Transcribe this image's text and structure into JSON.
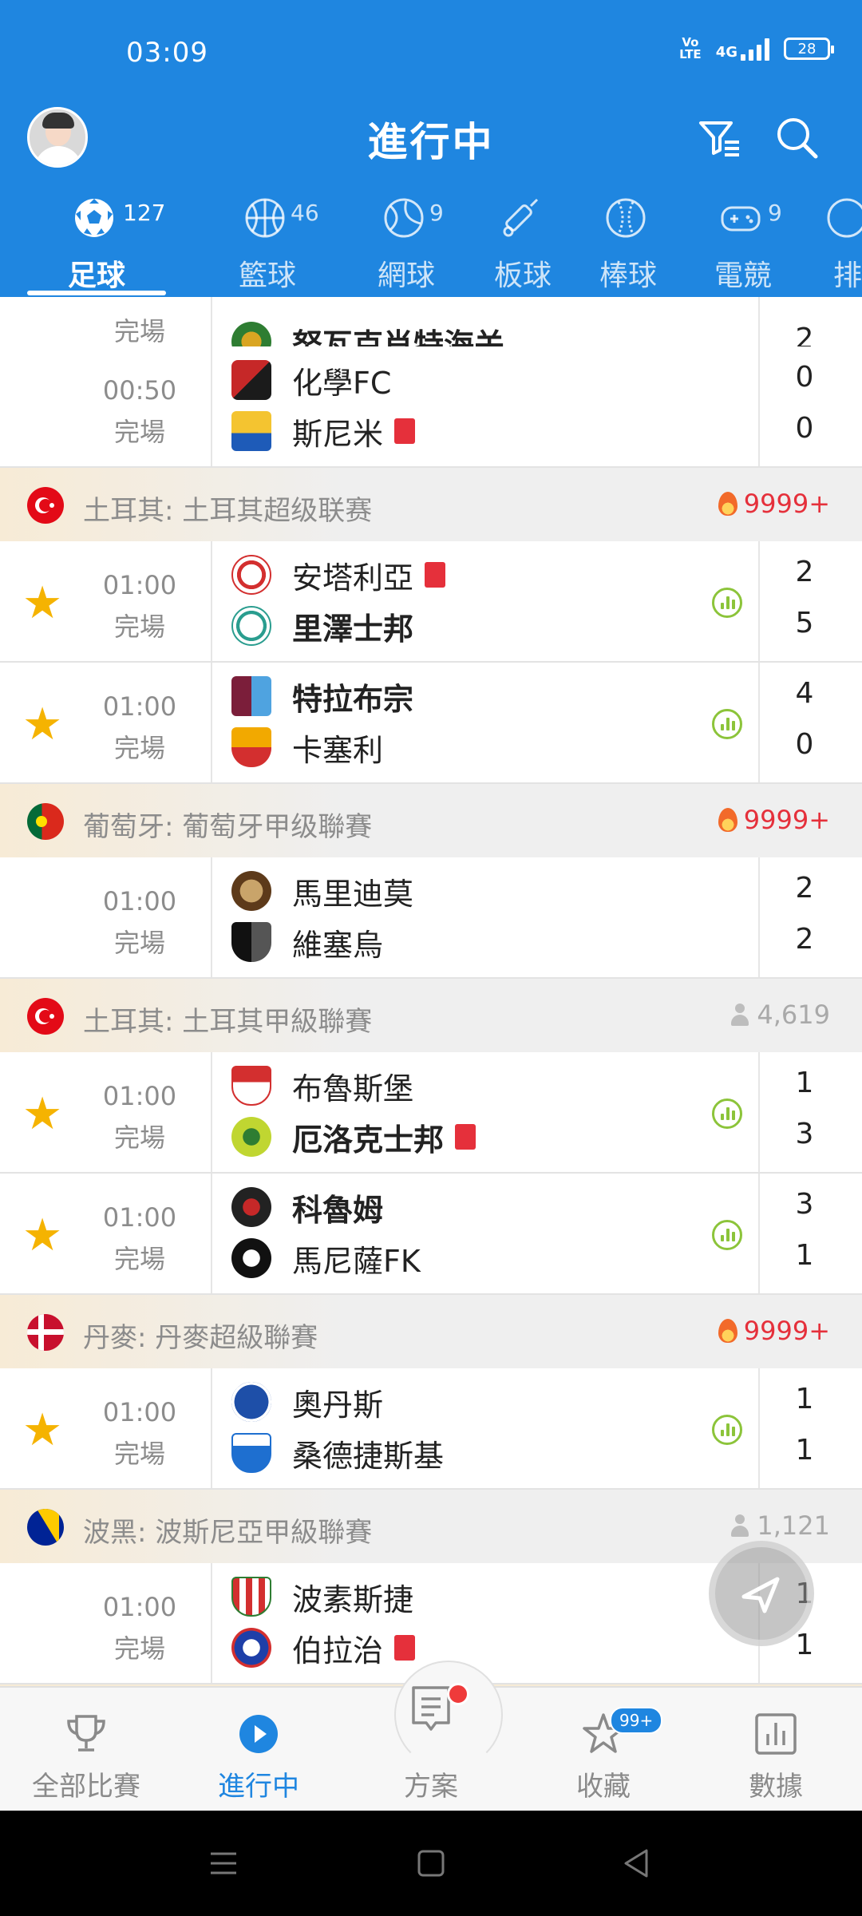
{
  "status_bar": {
    "time": "03:09",
    "network": "4G",
    "volte": "Vo\nLTE",
    "battery": "28"
  },
  "header": {
    "title": "進行中"
  },
  "sport_tabs": [
    {
      "label": "足球",
      "count": "127",
      "icon": "soccer-ball-icon",
      "active": true
    },
    {
      "label": "籃球",
      "count": "46",
      "icon": "basketball-icon"
    },
    {
      "label": "網球",
      "count": "9",
      "icon": "tennis-ball-icon"
    },
    {
      "label": "板球",
      "count": "",
      "icon": "cricket-bat-icon"
    },
    {
      "label": "棒球",
      "count": "",
      "icon": "baseball-icon"
    },
    {
      "label": "電競",
      "count": "9",
      "icon": "gamepad-icon"
    },
    {
      "label": "排",
      "count": "",
      "icon": "volleyball-icon"
    }
  ],
  "matches": {
    "m0": {
      "status": "完場",
      "away": "努瓦克肖特海关",
      "away_score": "2"
    },
    "m1": {
      "time": "00:50",
      "status": "完場",
      "home": "化學FC",
      "away": "斯尼米",
      "home_score": "0",
      "away_score": "0"
    },
    "l1": {
      "name": "土耳其: 土耳其超级联赛",
      "heat": "9999+"
    },
    "m2": {
      "time": "01:00",
      "status": "完場",
      "home": "安塔利亞",
      "away": "里澤士邦",
      "home_score": "2",
      "away_score": "5"
    },
    "m3": {
      "time": "01:00",
      "status": "完場",
      "home": "特拉布宗",
      "away": "卡塞利",
      "home_score": "4",
      "away_score": "0"
    },
    "l2": {
      "name": "葡萄牙: 葡萄牙甲级聯賽",
      "heat": "9999+"
    },
    "m4": {
      "time": "01:00",
      "status": "完場",
      "home": "馬里迪莫",
      "away": "維塞烏",
      "home_score": "2",
      "away_score": "2"
    },
    "l3": {
      "name": "土耳其: 土耳其甲級聯賽",
      "viewers": "4,619"
    },
    "m5": {
      "time": "01:00",
      "status": "完場",
      "home": "布魯斯堡",
      "away": "厄洛克士邦",
      "home_score": "1",
      "away_score": "3"
    },
    "m6": {
      "time": "01:00",
      "status": "完場",
      "home": "科魯姆",
      "away": "馬尼薩FK",
      "home_score": "3",
      "away_score": "1"
    },
    "l4": {
      "name": "丹麥: 丹麥超級聯賽",
      "heat": "9999+"
    },
    "m7": {
      "time": "01:00",
      "status": "完場",
      "home": "奧丹斯",
      "away": "桑德捷斯基",
      "home_score": "1",
      "away_score": "1"
    },
    "l5": {
      "name": "波黑: 波斯尼亞甲級聯賽",
      "viewers": "1,121"
    },
    "m8": {
      "time": "01:00",
      "status": "完場",
      "home": "波素斯捷",
      "away": "伯拉治",
      "home_score": "1",
      "away_score": "1"
    }
  },
  "bottom_nav": [
    {
      "label": "全部比賽",
      "icon": "trophy-icon"
    },
    {
      "label": "進行中",
      "icon": "play-icon",
      "active": true
    },
    {
      "label": "方案",
      "icon": "document-icon"
    },
    {
      "label": "收藏",
      "icon": "star-icon",
      "badge": "99+"
    },
    {
      "label": "數據",
      "icon": "chart-icon"
    }
  ],
  "colors": {
    "primary": "#1f86e0",
    "star": "#f5b301",
    "red_card": "#e5303b",
    "stats_green": "#8cc43a",
    "hot": "#e5303b"
  }
}
